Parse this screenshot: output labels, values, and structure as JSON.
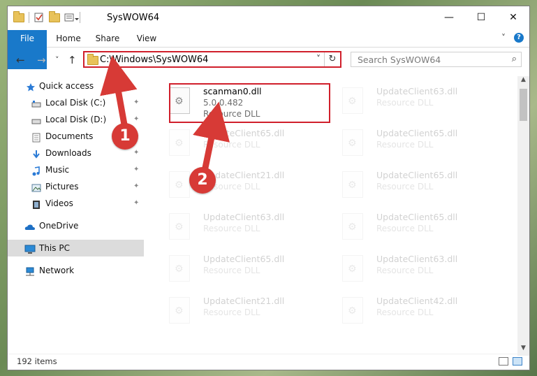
{
  "window": {
    "title": "SysWOW64",
    "buttons": {
      "minimize": "—",
      "maximize": "☐",
      "close": "✕"
    }
  },
  "ribbon": {
    "tabs": [
      "File",
      "Home",
      "Share",
      "View"
    ],
    "expand_glyph": "˅",
    "help_glyph": "?"
  },
  "nav": {
    "address": "C:\\Windows\\SysWOW64",
    "search_placeholder": "Search SysWOW64",
    "back": "←",
    "forward": "→",
    "recent": "˅",
    "up": "↑",
    "address_dropdown": "˅",
    "refresh": "↻",
    "search_icon": "⌕"
  },
  "sidebar": {
    "items": [
      {
        "label": "Quick access",
        "icon": "star-icon",
        "pinned": false
      },
      {
        "label": "Local Disk (C:)",
        "icon": "drive-icon",
        "pinned": true
      },
      {
        "label": "Local Disk (D:)",
        "icon": "drive-icon",
        "pinned": true
      },
      {
        "label": "Documents",
        "icon": "documents-icon",
        "pinned": true
      },
      {
        "label": "Downloads",
        "icon": "downloads-icon",
        "pinned": true
      },
      {
        "label": "Music",
        "icon": "music-icon",
        "pinned": true
      },
      {
        "label": "Pictures",
        "icon": "pictures-icon",
        "pinned": true
      },
      {
        "label": "Videos",
        "icon": "videos-icon",
        "pinned": true
      },
      {
        "label": "OneDrive",
        "icon": "cloud-icon",
        "pinned": false
      },
      {
        "label": "This PC",
        "icon": "pc-icon",
        "pinned": false,
        "selected": true
      },
      {
        "label": "Network",
        "icon": "network-icon",
        "pinned": false
      }
    ],
    "pin_glyph": "📌"
  },
  "files": [
    {
      "name": "scanman0.dll",
      "version": "5.0.0.482",
      "type": "Resource DLL",
      "highlighted": true
    },
    {
      "name": "UpdateClient63.dll",
      "version": "",
      "type": "Resource DLL"
    },
    {
      "name": "UpdateClient65.dll",
      "version": "",
      "type": "Resource DLL"
    },
    {
      "name": "UpdateClient65.dll",
      "version": "",
      "type": "Resource DLL"
    },
    {
      "name": "UpdateClient21.dll",
      "version": "",
      "type": "Resource DLL"
    },
    {
      "name": "UpdateClient65.dll",
      "version": "",
      "type": "Resource DLL"
    },
    {
      "name": "UpdateClient63.dll",
      "version": "",
      "type": "Resource DLL"
    },
    {
      "name": "UpdateClient65.dll",
      "version": "",
      "type": "Resource DLL"
    },
    {
      "name": "UpdateClient65.dll",
      "version": "",
      "type": "Resource DLL"
    },
    {
      "name": "UpdateClient63.dll",
      "version": "",
      "type": "Resource DLL"
    },
    {
      "name": "UpdateClient21.dll",
      "version": "",
      "type": "Resource DLL"
    },
    {
      "name": "UpdateClient42.dll",
      "version": "",
      "type": "Resource DLL"
    }
  ],
  "status": {
    "item_count": "192 items"
  },
  "callouts": {
    "one": "1",
    "two": "2"
  },
  "colors": {
    "accent": "#1979ca",
    "highlight": "#d01f2b",
    "callout": "#d73a36"
  }
}
